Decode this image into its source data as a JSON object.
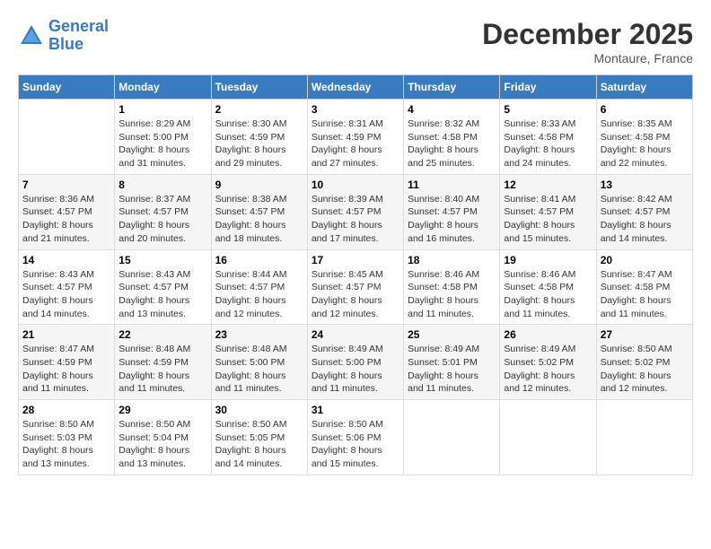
{
  "header": {
    "logo_line1": "General",
    "logo_line2": "Blue",
    "month": "December 2025",
    "location": "Montaure, France"
  },
  "weekdays": [
    "Sunday",
    "Monday",
    "Tuesday",
    "Wednesday",
    "Thursday",
    "Friday",
    "Saturday"
  ],
  "weeks": [
    [
      {
        "day": "",
        "info": ""
      },
      {
        "day": "1",
        "info": "Sunrise: 8:29 AM\nSunset: 5:00 PM\nDaylight: 8 hours\nand 31 minutes."
      },
      {
        "day": "2",
        "info": "Sunrise: 8:30 AM\nSunset: 4:59 PM\nDaylight: 8 hours\nand 29 minutes."
      },
      {
        "day": "3",
        "info": "Sunrise: 8:31 AM\nSunset: 4:59 PM\nDaylight: 8 hours\nand 27 minutes."
      },
      {
        "day": "4",
        "info": "Sunrise: 8:32 AM\nSunset: 4:58 PM\nDaylight: 8 hours\nand 25 minutes."
      },
      {
        "day": "5",
        "info": "Sunrise: 8:33 AM\nSunset: 4:58 PM\nDaylight: 8 hours\nand 24 minutes."
      },
      {
        "day": "6",
        "info": "Sunrise: 8:35 AM\nSunset: 4:58 PM\nDaylight: 8 hours\nand 22 minutes."
      }
    ],
    [
      {
        "day": "7",
        "info": "Sunrise: 8:36 AM\nSunset: 4:57 PM\nDaylight: 8 hours\nand 21 minutes."
      },
      {
        "day": "8",
        "info": "Sunrise: 8:37 AM\nSunset: 4:57 PM\nDaylight: 8 hours\nand 20 minutes."
      },
      {
        "day": "9",
        "info": "Sunrise: 8:38 AM\nSunset: 4:57 PM\nDaylight: 8 hours\nand 18 minutes."
      },
      {
        "day": "10",
        "info": "Sunrise: 8:39 AM\nSunset: 4:57 PM\nDaylight: 8 hours\nand 17 minutes."
      },
      {
        "day": "11",
        "info": "Sunrise: 8:40 AM\nSunset: 4:57 PM\nDaylight: 8 hours\nand 16 minutes."
      },
      {
        "day": "12",
        "info": "Sunrise: 8:41 AM\nSunset: 4:57 PM\nDaylight: 8 hours\nand 15 minutes."
      },
      {
        "day": "13",
        "info": "Sunrise: 8:42 AM\nSunset: 4:57 PM\nDaylight: 8 hours\nand 14 minutes."
      }
    ],
    [
      {
        "day": "14",
        "info": "Sunrise: 8:43 AM\nSunset: 4:57 PM\nDaylight: 8 hours\nand 14 minutes."
      },
      {
        "day": "15",
        "info": "Sunrise: 8:43 AM\nSunset: 4:57 PM\nDaylight: 8 hours\nand 13 minutes."
      },
      {
        "day": "16",
        "info": "Sunrise: 8:44 AM\nSunset: 4:57 PM\nDaylight: 8 hours\nand 12 minutes."
      },
      {
        "day": "17",
        "info": "Sunrise: 8:45 AM\nSunset: 4:57 PM\nDaylight: 8 hours\nand 12 minutes."
      },
      {
        "day": "18",
        "info": "Sunrise: 8:46 AM\nSunset: 4:58 PM\nDaylight: 8 hours\nand 11 minutes."
      },
      {
        "day": "19",
        "info": "Sunrise: 8:46 AM\nSunset: 4:58 PM\nDaylight: 8 hours\nand 11 minutes."
      },
      {
        "day": "20",
        "info": "Sunrise: 8:47 AM\nSunset: 4:58 PM\nDaylight: 8 hours\nand 11 minutes."
      }
    ],
    [
      {
        "day": "21",
        "info": "Sunrise: 8:47 AM\nSunset: 4:59 PM\nDaylight: 8 hours\nand 11 minutes."
      },
      {
        "day": "22",
        "info": "Sunrise: 8:48 AM\nSunset: 4:59 PM\nDaylight: 8 hours\nand 11 minutes."
      },
      {
        "day": "23",
        "info": "Sunrise: 8:48 AM\nSunset: 5:00 PM\nDaylight: 8 hours\nand 11 minutes."
      },
      {
        "day": "24",
        "info": "Sunrise: 8:49 AM\nSunset: 5:00 PM\nDaylight: 8 hours\nand 11 minutes."
      },
      {
        "day": "25",
        "info": "Sunrise: 8:49 AM\nSunset: 5:01 PM\nDaylight: 8 hours\nand 11 minutes."
      },
      {
        "day": "26",
        "info": "Sunrise: 8:49 AM\nSunset: 5:02 PM\nDaylight: 8 hours\nand 12 minutes."
      },
      {
        "day": "27",
        "info": "Sunrise: 8:50 AM\nSunset: 5:02 PM\nDaylight: 8 hours\nand 12 minutes."
      }
    ],
    [
      {
        "day": "28",
        "info": "Sunrise: 8:50 AM\nSunset: 5:03 PM\nDaylight: 8 hours\nand 13 minutes."
      },
      {
        "day": "29",
        "info": "Sunrise: 8:50 AM\nSunset: 5:04 PM\nDaylight: 8 hours\nand 13 minutes."
      },
      {
        "day": "30",
        "info": "Sunrise: 8:50 AM\nSunset: 5:05 PM\nDaylight: 8 hours\nand 14 minutes."
      },
      {
        "day": "31",
        "info": "Sunrise: 8:50 AM\nSunset: 5:06 PM\nDaylight: 8 hours\nand 15 minutes."
      },
      {
        "day": "",
        "info": ""
      },
      {
        "day": "",
        "info": ""
      },
      {
        "day": "",
        "info": ""
      }
    ]
  ]
}
